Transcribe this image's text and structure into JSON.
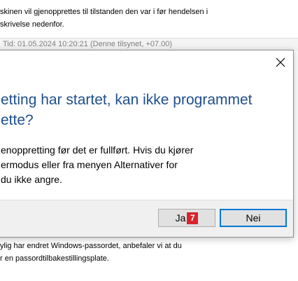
{
  "background": {
    "top_lines": [
      "skinen vil gjenopprettes til tilstanden den var i før hendelsen i",
      "skrivelse nedenfor."
    ],
    "strip_text": "Tid:  01.05.2024 10:20:21 (Denne tilsynet, +07.00)",
    "bottom_lines": [
      "ylig har endret Windows-passordet, anbefaler vi at du",
      "r en passordtilbakestillingsplate."
    ]
  },
  "dialog": {
    "close_glyph": "✕",
    "heading_lines": [
      "etting har startet, kan ikke programmet",
      "ette?"
    ],
    "body_lines": [
      "enoppretting før det er fullført. Hvis du kjører",
      "ermodus eller fra menyen Alternativer for",
      "du ikke angre."
    ],
    "buttons": {
      "yes_label": "Ja",
      "yes_badge": "7",
      "no_label": "Nei"
    }
  },
  "colors": {
    "heading": "#1f4e8c",
    "focus_border": "#0078d7",
    "badge": "#d9232d"
  }
}
